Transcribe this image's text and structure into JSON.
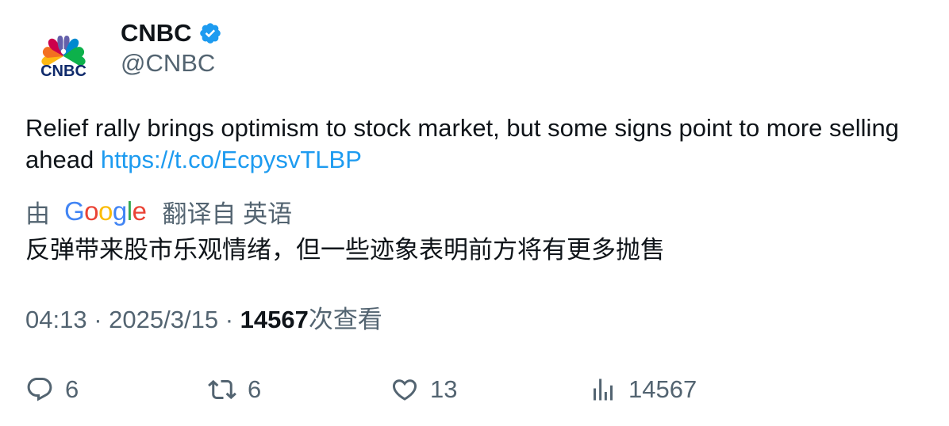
{
  "author": {
    "display_name": "CNBC",
    "handle": "@CNBC",
    "verified": true,
    "avatar_logo_text": "CNBC"
  },
  "tweet": {
    "text": "Relief rally brings optimism to stock market, but some signs point to more selling ahead ",
    "link": "https://t.co/EcpysvTLBP"
  },
  "translation": {
    "by_label": "由",
    "provider": "Google",
    "from_label": "翻译自 英语",
    "text": "反弹带来股市乐观情绪，但一些迹象表明前方将有更多抛售"
  },
  "meta": {
    "time": "04:13",
    "separator": "·",
    "date": "2025/3/15",
    "views_count": "14567",
    "views_label": "次查看"
  },
  "actions": {
    "reply": {
      "icon": "reply-icon",
      "count": "6"
    },
    "retweet": {
      "icon": "retweet-icon",
      "count": "6"
    },
    "like": {
      "icon": "heart-icon",
      "count": "13"
    },
    "views": {
      "icon": "views-chart-icon",
      "count": "14567"
    }
  },
  "colors": {
    "text": "#0f1419",
    "muted": "#536471",
    "link": "#1d9bf0",
    "verified": "#1d9bf0"
  }
}
